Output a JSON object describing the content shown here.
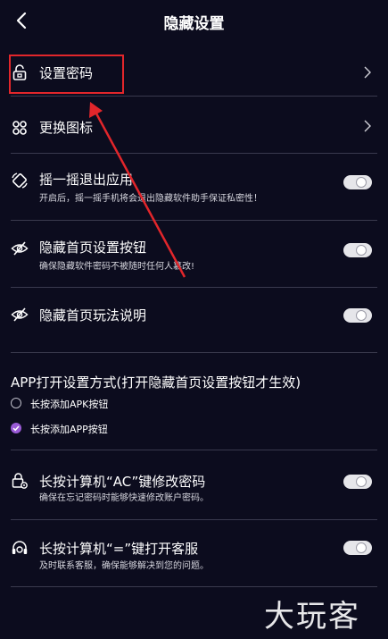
{
  "header": {
    "title": "隐藏设置"
  },
  "rows": [
    {
      "title": "设置密码",
      "control": "chevron",
      "icon": "lock-icon"
    },
    {
      "title": "更换图标",
      "control": "chevron",
      "icon": "command-icon"
    },
    {
      "title": "摇一摇退出应用",
      "subtitle": "开启后，摇一摇手机将会退出隐藏软件助手保证私密性！",
      "control": "toggle",
      "toggle_on": false,
      "icon": "shake-icon"
    },
    {
      "title": "隐藏首页设置按钮",
      "subtitle": "确保隐藏软件密码不被随时任何人篡改!",
      "control": "toggle",
      "toggle_on": false,
      "icon": "eye-hidden-icon"
    },
    {
      "title": "隐藏首页玩法说明",
      "control": "toggle",
      "toggle_on": false,
      "icon": "eye-hidden-icon"
    }
  ],
  "app_mode": {
    "title": "APP打开设置方式(打开隐藏首页设置按钮才生效)",
    "options": [
      {
        "label": "长按添加APK按钮",
        "selected": false
      },
      {
        "label": "长按添加APP按钮",
        "selected": true
      }
    ]
  },
  "rows2": [
    {
      "title": "长按计算机“AC”键修改密码",
      "subtitle": "确保在忘记密码时能够快速修改账户密码。",
      "control": "toggle",
      "toggle_on": false,
      "icon": "lock-gear-icon"
    },
    {
      "title": "长按计算机“=”键打开客服",
      "subtitle": "及时联系客服，确保能够解决到您的问题。",
      "control": "toggle",
      "toggle_on": false,
      "icon": "headset-icon"
    }
  ],
  "watermark": "大玩客",
  "colors": {
    "background": "#0c0c1e",
    "accent": "#9a5bd6",
    "annotation": "#e2262b"
  }
}
